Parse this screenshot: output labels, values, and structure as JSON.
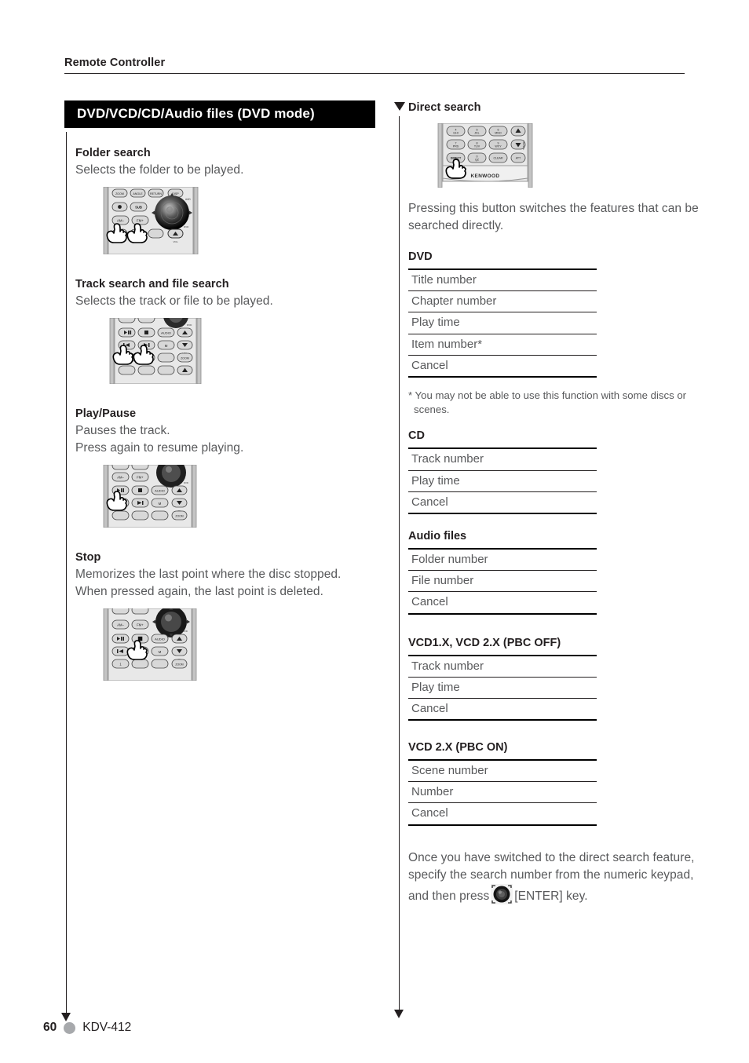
{
  "header": {
    "title": "Remote Controller"
  },
  "left_column": {
    "section_bar": "DVD/VCD/CD/Audio files (DVD mode)",
    "entries": [
      {
        "title": "Folder search",
        "lines": [
          "Selects the folder to be played."
        ],
        "figure": "remote-folder-search"
      },
      {
        "title": "Track search and file search",
        "lines": [
          "Selects the track or file to be played."
        ],
        "figure": "remote-track-search"
      },
      {
        "title": "Play/Pause",
        "lines": [
          "Pauses the track.",
          "Press again to resume playing."
        ],
        "figure": "remote-play-pause"
      },
      {
        "title": "Stop",
        "lines": [
          "Memorizes the last point where the disc stopped.",
          "When pressed again, the last point is deleted."
        ],
        "figure": "remote-stop"
      }
    ]
  },
  "right_column": {
    "title": "Direct search",
    "figure": "remote-direct-search",
    "intro": "Pressing this button switches the features that can be searched directly.",
    "tables": [
      {
        "caption": "DVD",
        "rows": [
          "Title number",
          "Chapter number",
          "Play time",
          "Item number*",
          "Cancel"
        ]
      },
      {
        "caption": "CD",
        "rows": [
          "Track number",
          "Play time",
          "Cancel"
        ]
      },
      {
        "caption": "Audio files",
        "rows": [
          "Folder number",
          "File number",
          "Cancel"
        ]
      },
      {
        "caption": "VCD1.X, VCD 2.X (PBC OFF)",
        "rows": [
          "Track number",
          "Play time",
          "Cancel"
        ]
      },
      {
        "caption": "VCD 2.X (PBC ON)",
        "rows": [
          "Scene number",
          "Number",
          "Cancel"
        ]
      }
    ],
    "footnote": "* You may not be able to use this function with some discs or scenes.",
    "outro_before": "Once you have switched to the direct search feature, specify the search number from the numeric keypad, and then press",
    "outro_after": "[ENTER] key."
  },
  "remote_buttons": {
    "zoom": "ZOOM",
    "angle": "ANGLE",
    "return": "RETURN",
    "display": "DISP",
    "subtitle": "SUB TITLE",
    "audio_dvd": "AUDIO",
    "am_minus": "AM −",
    "fm_plus": "FM +",
    "play_pause": "▶❙❙",
    "stop": "■",
    "audio": "AUDIO",
    "prev": "|◀◀",
    "next": "▶▶|",
    "mute": "MUTE",
    "vol_up": "▲",
    "vol_down": "▼",
    "vol_label": "VOL",
    "fncvol": "FNC/VOL",
    "att": "ATT",
    "direct": "DIRECT",
    "clear": "CLEAR",
    "key_4": "4 GHI",
    "key_5": "5 JKL",
    "key_6": "6 MNO",
    "key_7": "7 PRS",
    "key_8": "8 TUV",
    "key_9": "9 WXY",
    "key_0": "0",
    "key_1": "1",
    "dvd_top": "DVD TOP"
  },
  "footer": {
    "page_number": "60",
    "model": "KDV-412"
  }
}
